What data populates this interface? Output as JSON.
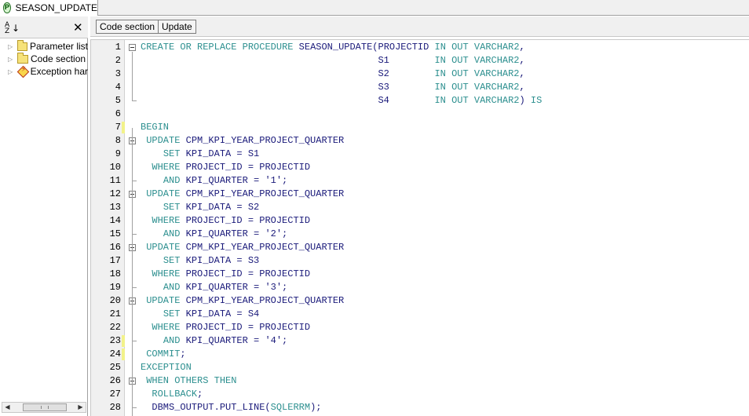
{
  "window": {
    "tab_title": "SEASON_UPDATE",
    "tab_icon": "procedure-icon"
  },
  "left_panel": {
    "close_glyph": "✕",
    "tree": [
      {
        "label": "Parameter list",
        "icon": "folder-icon"
      },
      {
        "label": "Code section",
        "icon": "folder-icon"
      },
      {
        "label": "Exception har",
        "icon": "exception-icon"
      }
    ]
  },
  "toolbar": {
    "code_section_label": "Code section",
    "update_label": "Update"
  },
  "editor": {
    "colors": {
      "keyword": "#2c8f8f",
      "identifier": "#1a1a7a",
      "change_marker": "#f2f28a"
    },
    "lines": [
      {
        "n": "1",
        "tokens": [
          [
            "k",
            "CREATE"
          ],
          [
            "i",
            " "
          ],
          [
            "k",
            "OR"
          ],
          [
            "i",
            " "
          ],
          [
            "k",
            "REPLACE"
          ],
          [
            "i",
            " "
          ],
          [
            "k",
            "PROCEDURE"
          ],
          [
            "i",
            " SEASON_UPDATE(PROJECTID "
          ],
          [
            "k",
            "IN"
          ],
          [
            "i",
            " "
          ],
          [
            "k",
            "OUT"
          ],
          [
            "i",
            " "
          ],
          [
            "k",
            "VARCHAR2"
          ],
          [
            "i",
            ","
          ]
        ]
      },
      {
        "n": "2",
        "tokens": [
          [
            "i",
            "                                          S1        "
          ],
          [
            "k",
            "IN"
          ],
          [
            "i",
            " "
          ],
          [
            "k",
            "OUT"
          ],
          [
            "i",
            " "
          ],
          [
            "k",
            "VARCHAR2"
          ],
          [
            "i",
            ","
          ]
        ]
      },
      {
        "n": "3",
        "tokens": [
          [
            "i",
            "                                          S2        "
          ],
          [
            "k",
            "IN"
          ],
          [
            "i",
            " "
          ],
          [
            "k",
            "OUT"
          ],
          [
            "i",
            " "
          ],
          [
            "k",
            "VARCHAR2"
          ],
          [
            "i",
            ","
          ]
        ]
      },
      {
        "n": "4",
        "tokens": [
          [
            "i",
            "                                          S3        "
          ],
          [
            "k",
            "IN"
          ],
          [
            "i",
            " "
          ],
          [
            "k",
            "OUT"
          ],
          [
            "i",
            " "
          ],
          [
            "k",
            "VARCHAR2"
          ],
          [
            "i",
            ","
          ]
        ]
      },
      {
        "n": "5",
        "tokens": [
          [
            "i",
            "                                          S4        "
          ],
          [
            "k",
            "IN"
          ],
          [
            "i",
            " "
          ],
          [
            "k",
            "OUT"
          ],
          [
            "i",
            " "
          ],
          [
            "k",
            "VARCHAR2"
          ],
          [
            "i",
            ") "
          ],
          [
            "k",
            "IS"
          ]
        ]
      },
      {
        "n": "6",
        "tokens": []
      },
      {
        "n": "7",
        "tokens": [
          [
            "k",
            "BEGIN"
          ]
        ]
      },
      {
        "n": "8",
        "tokens": [
          [
            "i",
            " "
          ],
          [
            "k",
            "UPDATE"
          ],
          [
            "i",
            " CPM_KPI_YEAR_PROJECT_QUARTER"
          ]
        ]
      },
      {
        "n": "9",
        "tokens": [
          [
            "i",
            "    "
          ],
          [
            "k",
            "SET"
          ],
          [
            "i",
            " KPI_DATA = S1"
          ]
        ]
      },
      {
        "n": "10",
        "tokens": [
          [
            "i",
            "  "
          ],
          [
            "k",
            "WHERE"
          ],
          [
            "i",
            " PROJECT_ID = PROJECTID"
          ]
        ]
      },
      {
        "n": "11",
        "tokens": [
          [
            "i",
            "    "
          ],
          [
            "k",
            "AND"
          ],
          [
            "i",
            " KPI_QUARTER = '1';"
          ]
        ]
      },
      {
        "n": "12",
        "tokens": [
          [
            "i",
            " "
          ],
          [
            "k",
            "UPDATE"
          ],
          [
            "i",
            " CPM_KPI_YEAR_PROJECT_QUARTER"
          ]
        ]
      },
      {
        "n": "13",
        "tokens": [
          [
            "i",
            "    "
          ],
          [
            "k",
            "SET"
          ],
          [
            "i",
            " KPI_DATA = S2"
          ]
        ]
      },
      {
        "n": "14",
        "tokens": [
          [
            "i",
            "  "
          ],
          [
            "k",
            "WHERE"
          ],
          [
            "i",
            " PROJECT_ID = PROJECTID"
          ]
        ]
      },
      {
        "n": "15",
        "tokens": [
          [
            "i",
            "    "
          ],
          [
            "k",
            "AND"
          ],
          [
            "i",
            " KPI_QUARTER = '2';"
          ]
        ]
      },
      {
        "n": "16",
        "tokens": [
          [
            "i",
            " "
          ],
          [
            "k",
            "UPDATE"
          ],
          [
            "i",
            " CPM_KPI_YEAR_PROJECT_QUARTER"
          ]
        ]
      },
      {
        "n": "17",
        "tokens": [
          [
            "i",
            "    "
          ],
          [
            "k",
            "SET"
          ],
          [
            "i",
            " KPI_DATA = S3"
          ]
        ]
      },
      {
        "n": "18",
        "tokens": [
          [
            "i",
            "  "
          ],
          [
            "k",
            "WHERE"
          ],
          [
            "i",
            " PROJECT_ID = PROJECTID"
          ]
        ]
      },
      {
        "n": "19",
        "tokens": [
          [
            "i",
            "    "
          ],
          [
            "k",
            "AND"
          ],
          [
            "i",
            " KPI_QUARTER = '3';"
          ]
        ]
      },
      {
        "n": "20",
        "tokens": [
          [
            "i",
            " "
          ],
          [
            "k",
            "UPDATE"
          ],
          [
            "i",
            " CPM_KPI_YEAR_PROJECT_QUARTER"
          ]
        ]
      },
      {
        "n": "21",
        "tokens": [
          [
            "i",
            "    "
          ],
          [
            "k",
            "SET"
          ],
          [
            "i",
            " KPI_DATA = S4"
          ]
        ]
      },
      {
        "n": "22",
        "tokens": [
          [
            "i",
            "  "
          ],
          [
            "k",
            "WHERE"
          ],
          [
            "i",
            " PROJECT_ID = PROJECTID"
          ]
        ]
      },
      {
        "n": "23",
        "tokens": [
          [
            "i",
            "    "
          ],
          [
            "k",
            "AND"
          ],
          [
            "i",
            " KPI_QUARTER = '4';"
          ]
        ]
      },
      {
        "n": "24",
        "tokens": [
          [
            "i",
            " "
          ],
          [
            "k",
            "COMMIT"
          ],
          [
            "i",
            ";"
          ]
        ]
      },
      {
        "n": "25",
        "tokens": [
          [
            "k",
            "EXCEPTION"
          ]
        ]
      },
      {
        "n": "26",
        "tokens": [
          [
            "i",
            " "
          ],
          [
            "k",
            "WHEN"
          ],
          [
            "i",
            " "
          ],
          [
            "k",
            "OTHERS"
          ],
          [
            "i",
            " "
          ],
          [
            "k",
            "THEN"
          ]
        ]
      },
      {
        "n": "27",
        "tokens": [
          [
            "i",
            "  "
          ],
          [
            "k",
            "ROLLBACK"
          ],
          [
            "i",
            ";"
          ]
        ]
      },
      {
        "n": "28",
        "tokens": [
          [
            "i",
            "  DBMS_OUTPUT.PUT_LINE("
          ],
          [
            "k",
            "SQLERRM"
          ],
          [
            "i",
            ");"
          ]
        ]
      }
    ]
  }
}
